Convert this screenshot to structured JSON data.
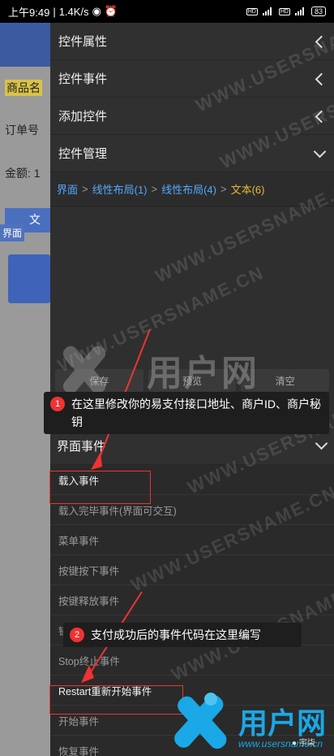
{
  "statusbar": {
    "time": "上午9:49",
    "speed": "1.4K/s",
    "battery": "83"
  },
  "background_app": {
    "row1": "商品名",
    "row2": "订单号",
    "row3": "金额: 1",
    "tag": "界面",
    "tag2": "文"
  },
  "menu": [
    {
      "label": "控件属性",
      "chevron": "chevron-left-icon"
    },
    {
      "label": "控件事件",
      "chevron": "chevron-left-icon"
    },
    {
      "label": "添加控件",
      "chevron": "chevron-left-icon"
    },
    {
      "label": "控件管理",
      "chevron": "chevron-down-icon"
    }
  ],
  "breadcrumb": {
    "items": [
      "界面",
      "线性布局(1)",
      "线性布局(4)"
    ],
    "current": "文本(6)",
    "separator": ">"
  },
  "buttons": [
    "保存",
    "预览",
    "清空"
  ],
  "section": {
    "title": "界面事件"
  },
  "events": [
    "载入事件",
    "载入完毕事件(界面可交互)",
    "菜单事件",
    "按键按下事件",
    "按键释放事件",
    "销毁事件",
    "Stop终止事件",
    "Restart重新开始事件",
    "开始事件",
    "恢复事件"
  ],
  "callouts": [
    {
      "num": "1",
      "text": "在这里修改你的易支付接口地址、商户ID、商户秘钥"
    },
    {
      "num": "2",
      "text": "支付成功后的事件代码在这里编写"
    }
  ],
  "watermark": {
    "text": "WWW.USERSNAME.CN",
    "logo_text": "用户网"
  },
  "corner_logo": {
    "title": "用户网",
    "url": "www.usersname.cn",
    "account": "宇柒"
  },
  "colors": {
    "link": "#55a8ff",
    "current": "#e8b83a",
    "highlight": "#e33333"
  }
}
